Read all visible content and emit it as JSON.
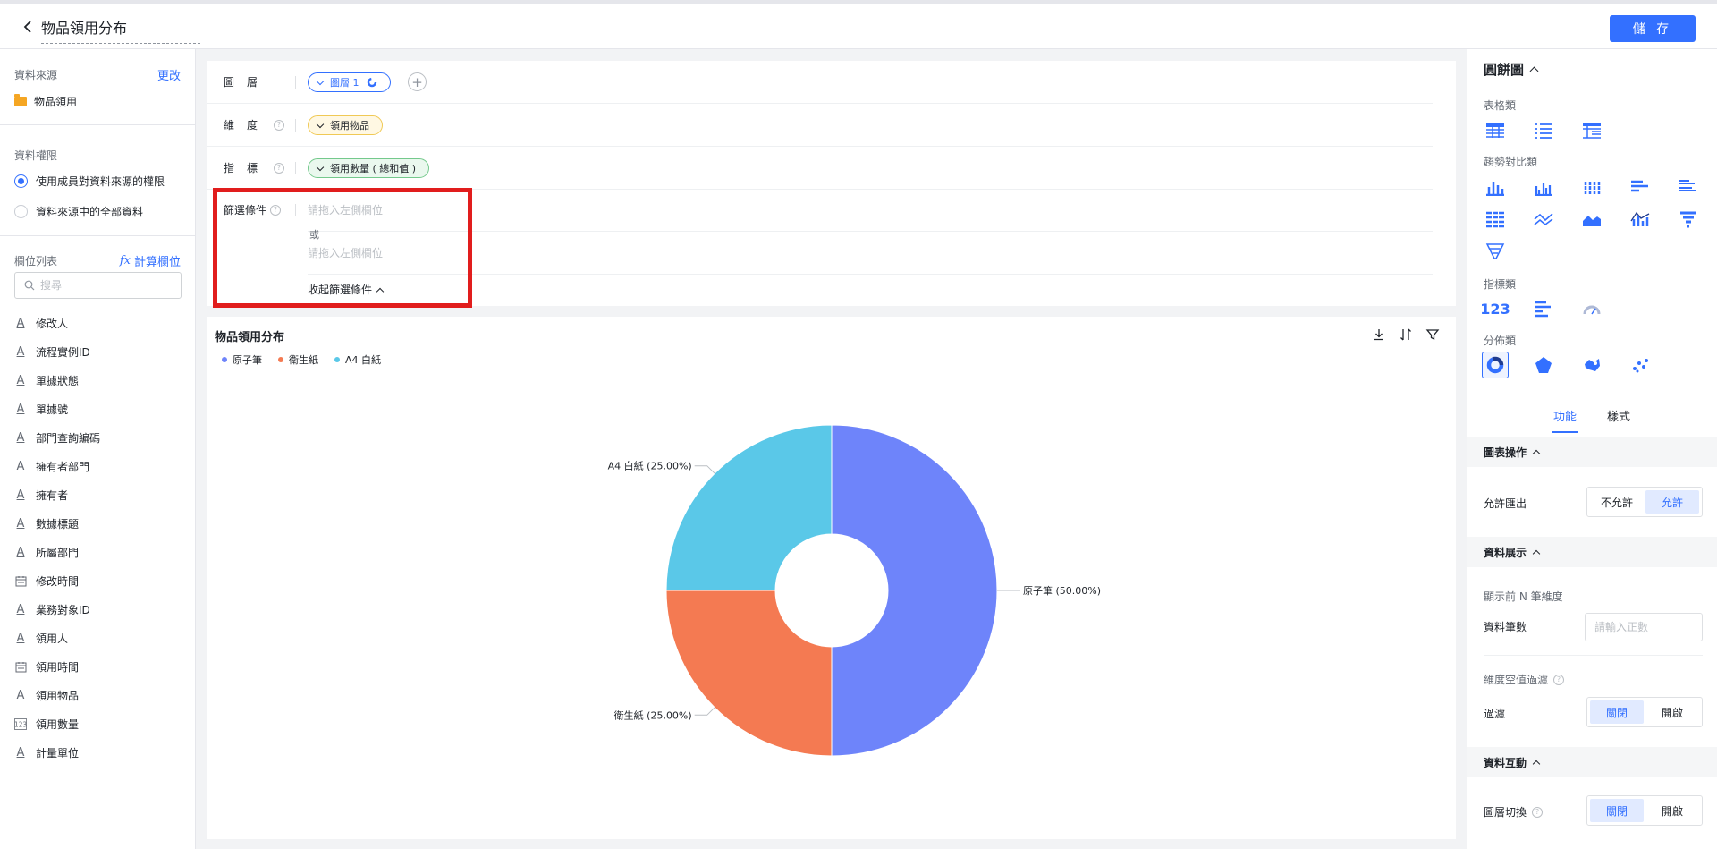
{
  "header": {
    "title": "物品領用分布",
    "save_label": "儲 存"
  },
  "left": {
    "datasource_label": "資料來源",
    "datasource_change": "更改",
    "datasource_name": "物品領用",
    "permission_label": "資料權限",
    "permission_options": [
      "使用成員對資料來源的權限",
      "資料來源中的全部資料"
    ],
    "fields_label": "欄位列表",
    "calc_field": "計算欄位",
    "search_placeholder": "搜尋",
    "fields": [
      {
        "icon": "text",
        "label": "修改人"
      },
      {
        "icon": "text",
        "label": "流程實例ID"
      },
      {
        "icon": "text",
        "label": "單據狀態"
      },
      {
        "icon": "text",
        "label": "單據號"
      },
      {
        "icon": "text",
        "label": "部門查詢編碼"
      },
      {
        "icon": "text",
        "label": "擁有者部門"
      },
      {
        "icon": "text",
        "label": "擁有者"
      },
      {
        "icon": "text",
        "label": "數據標題"
      },
      {
        "icon": "text",
        "label": "所屬部門"
      },
      {
        "icon": "date",
        "label": "修改時間"
      },
      {
        "icon": "text",
        "label": "業務對象ID"
      },
      {
        "icon": "text",
        "label": "領用人"
      },
      {
        "icon": "date",
        "label": "領用時間"
      },
      {
        "icon": "text",
        "label": "領用物品"
      },
      {
        "icon": "number",
        "label": "領用數量"
      },
      {
        "icon": "text",
        "label": "計量單位"
      }
    ]
  },
  "config": {
    "layer_label": "圖層",
    "layer_value": "圖層 1",
    "dimension_label": "維度",
    "dimension_value": "領用物品",
    "metric_label": "指標",
    "metric_value": "領用數量 ( 總和值 )",
    "filter_label": "篩選條件",
    "filter_placeholder_1": "請拖入左側欄位",
    "filter_or": "或",
    "filter_placeholder_2": "請拖入左側欄位",
    "collapse_filter": "收起篩選條件"
  },
  "chart_data": {
    "type": "pie",
    "title": "物品領用分布",
    "donut": true,
    "categories": [
      "原子筆",
      "衛生紙",
      "A4 白紙"
    ],
    "values": [
      50,
      25,
      25
    ],
    "labels": [
      "原子筆 (50.00%)",
      "衛生紙 (25.00%)",
      "A4 白紙 (25.00%)"
    ],
    "colors": [
      "#6e84fa",
      "#f47a52",
      "#5ac8e8"
    ],
    "legend_position": "top-left"
  },
  "right": {
    "chart_type_title": "圓餅圖",
    "groups": [
      "表格類",
      "趨勢對比類",
      "指標類",
      "分佈類"
    ],
    "indicator_text": "123",
    "tabs": [
      "功能",
      "樣式"
    ],
    "sec_chart_ops": "圖表操作",
    "allow_export_label": "允許匯出",
    "allow_export_options": [
      "不允許",
      "允許"
    ],
    "sec_data_display": "資料展示",
    "top_n_label": "顯示前 N 筆維度",
    "data_count_label": "資料筆數",
    "data_count_placeholder": "請輸入正數",
    "null_filter_label": "維度空值過濾",
    "filter_label": "過濾",
    "filter_options": [
      "關閉",
      "開啟"
    ],
    "sec_interaction": "資料互動",
    "layer_switch_label": "圖層切換",
    "layer_switch_options": [
      "關閉",
      "開啟"
    ]
  }
}
